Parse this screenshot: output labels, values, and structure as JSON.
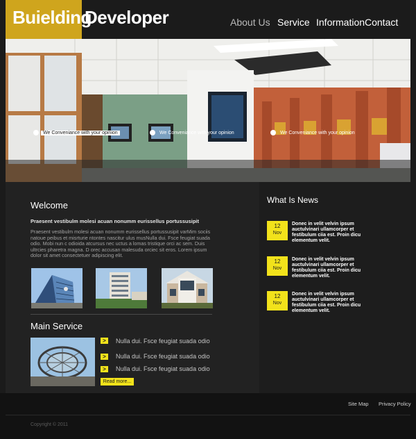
{
  "brand": {
    "part1": "Buielding",
    "part2": "Developer",
    "accent": "#cfa51d"
  },
  "nav": [
    {
      "label": "About Us"
    },
    {
      "label": "Service"
    },
    {
      "label": "Information"
    },
    {
      "label": "Contact"
    }
  ],
  "hero": {
    "captions": [
      "We Conveniance with your opinion",
      "We Conveniance with your opinion",
      "We Conveniance with your opinion"
    ]
  },
  "welcome": {
    "title": "Welcome",
    "subtitle": "Praesent vestibulm molesi acuan nonumm eurissellus portussusipit",
    "body": "Praesent vestibulm molesi acuan nonumm eurissellus portussusipit varMim sociis natoue peibus et misrturie ntontes nascitur ulus musNulla dui. Fsce feugiat suada odio. Mobi nun c odioida atcursus nec uctus a lomas tristique orci ac sem. Duis ultrcies pharetra magna. D orec accusan malesuda orciec sit eros. Lorem ipsum dolor sit amet consectetuer adipiscing elit."
  },
  "main_service": {
    "title": "Main Service",
    "items": [
      "Nulla dui. Fsce feugiat suada odio",
      "Nulla dui. Fsce feugiat suada odio",
      "Nulla dui. Fsce feugiat suada odio"
    ],
    "arrow": ">",
    "read_more": "Read more..."
  },
  "news": {
    "title": "What Is News",
    "items": [
      {
        "day": "12",
        "month": "Nov",
        "text": "Donec in velit velvin ipsum auctulvinari ullamcorper et festibulum ciia est. Proin dicu elementum velit."
      },
      {
        "day": "12",
        "month": "Nov",
        "text": "Donec in velit velvin ipsum auctulvinari ullamcorper et festibulum ciia est. Proin dicu elementum velit."
      },
      {
        "day": "12",
        "month": "Nov",
        "text": "Donec in velit velvin ipsum auctulvinari ullamcorper et festibulum ciia est. Proin dicu elementum velit."
      }
    ]
  },
  "footer": {
    "links": [
      {
        "label": "Site Map"
      },
      {
        "label": "Privacy Policy"
      }
    ],
    "copyright": "Copyright © 2011"
  },
  "colors": {
    "highlight": "#f2e21b",
    "background": "#1b1b1b"
  }
}
